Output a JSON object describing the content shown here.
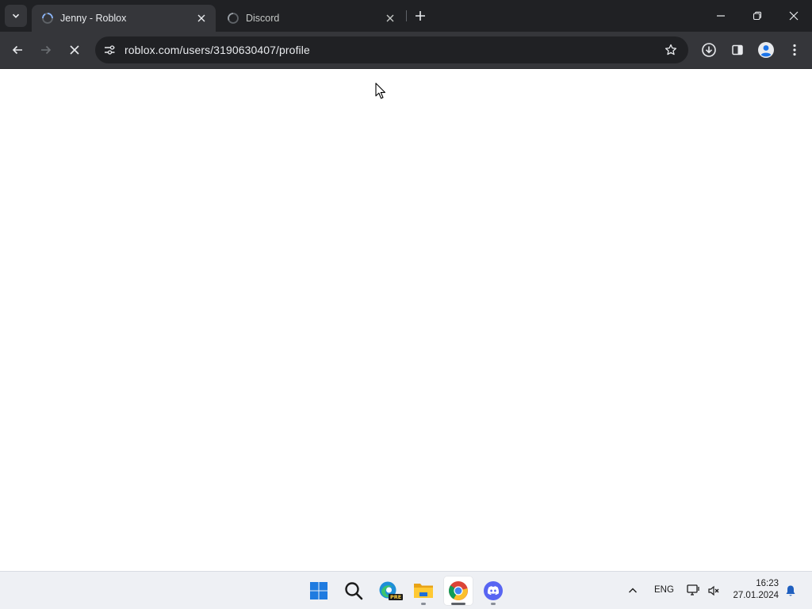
{
  "browser": {
    "tabs": [
      {
        "title": "Jenny - Roblox",
        "active": true,
        "loading": true
      },
      {
        "title": "Discord",
        "active": false,
        "loading": true
      }
    ],
    "address_bar": {
      "url": "roblox.com/users/3190630407/profile"
    },
    "toolbar_icons": [
      "back-arrow-icon",
      "forward-arrow-icon",
      "stop-loading-icon",
      "site-info-icon",
      "bookmark-star-icon",
      "download-icon",
      "side-panel-icon",
      "profile-avatar-icon",
      "more-menu-icon"
    ]
  },
  "taskbar": {
    "apps": [
      "windows-start-icon",
      "search-icon",
      "edge-preview-icon",
      "file-explorer-icon",
      "chrome-icon",
      "discord-icon"
    ],
    "edge_badge": "PRE",
    "language": "ENG",
    "time": "16:23",
    "date": "27.01.2024"
  },
  "colors": {
    "tabstrip_bg": "#202124",
    "toolbar_bg": "#35363a",
    "omnibox_bg": "#202124",
    "accent_blue": "#8ab4f8",
    "taskbar_bg": "#eef0f4"
  }
}
